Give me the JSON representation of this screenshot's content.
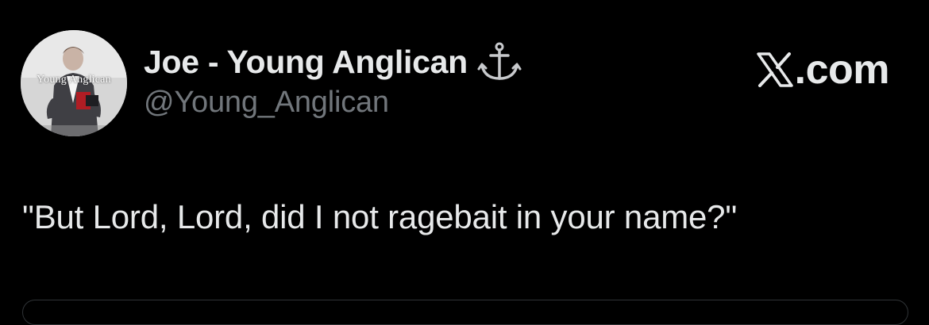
{
  "tweet": {
    "display_name": "Joe - Young Anglican",
    "handle": "@Young_Anglican",
    "text": "\"But Lord, Lord, did I not ragebait in your name?\"",
    "avatar_overlay_text": "Young Anglican",
    "badge_icon": "anchor-icon"
  },
  "brand": {
    "logo_icon": "x-logo-icon",
    "label": ".com"
  },
  "colors": {
    "background": "#000000",
    "primary_text": "#e7e9ea",
    "secondary_text": "#71767b",
    "border": "#2f3336"
  }
}
